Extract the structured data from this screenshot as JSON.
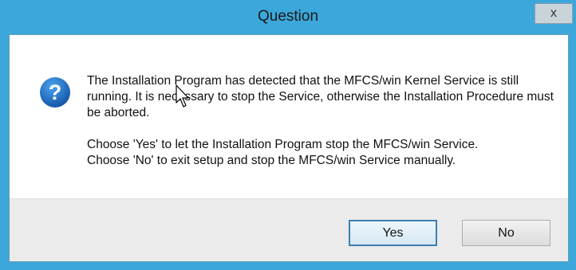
{
  "window": {
    "title": "Question",
    "close_glyph": "x"
  },
  "message": {
    "icon": "question-icon",
    "paragraph1": "The Installation Program has detected that the MFCS/win Kernel Service is still running. It is necessary to stop the Service, otherwise the Installation Procedure must be aborted.",
    "paragraph2_line1": "Choose 'Yes' to let the Installation Program stop the MFCS/win Service.",
    "paragraph2_line2": "Choose 'No' to exit setup and stop the MFCS/win Service manually."
  },
  "buttons": {
    "yes_label": "Yes",
    "no_label": "No"
  },
  "colors": {
    "frame": "#3ba7da",
    "icon": "#1f6fc0",
    "default_button_border": "#3c7fb1"
  }
}
